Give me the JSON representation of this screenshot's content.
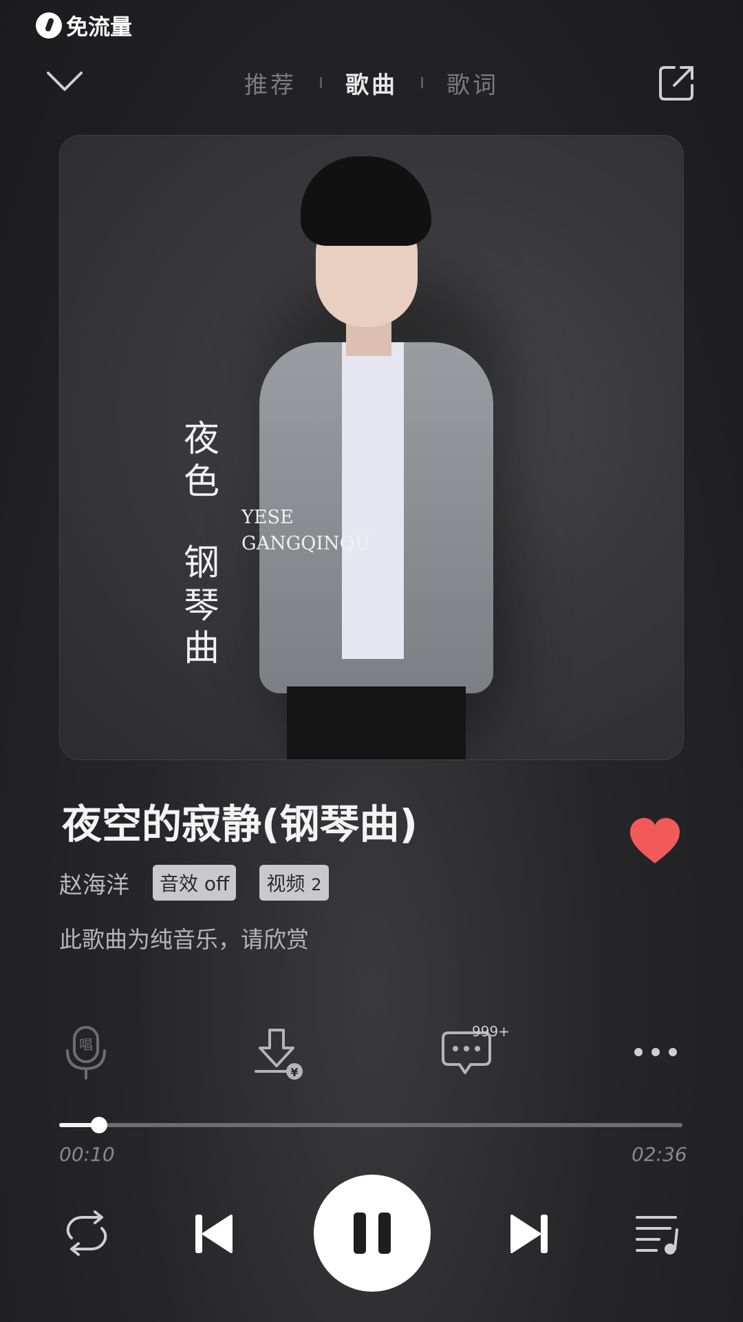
{
  "status_bar": {
    "free_data_label": "免流量"
  },
  "tabs": [
    {
      "label": "推荐",
      "active": false
    },
    {
      "label": "歌曲",
      "active": true
    },
    {
      "label": "歌词",
      "active": false
    }
  ],
  "cover": {
    "title_line1": "夜色",
    "title_line2": "钢琴曲",
    "subtitle_en_1": "YESE",
    "subtitle_en_2": "GANGQINQU"
  },
  "song": {
    "title": "夜空的寂静(钢琴曲)",
    "artist": "赵海洋",
    "sound_effect_tag": "音效 off",
    "video_tag_label": "视频",
    "video_tag_count": "2",
    "note": "此歌曲为纯音乐，请欣赏",
    "favorited": true
  },
  "actions": {
    "sing_icon_text": "唱",
    "download_badge": "¥",
    "comment_count": "999+"
  },
  "playback": {
    "current_time": "00:10",
    "total_time": "02:36",
    "progress_fraction": 0.064,
    "playing": true
  },
  "colors": {
    "accent_heart": "#f25a5a",
    "background": "#262628"
  },
  "icons": [
    "collapse-chevron-icon",
    "share-icon",
    "heart-icon",
    "mic-icon",
    "download-icon",
    "comment-icon",
    "more-icon",
    "repeat-icon",
    "previous-icon",
    "pause-icon",
    "next-icon",
    "playlist-icon"
  ]
}
